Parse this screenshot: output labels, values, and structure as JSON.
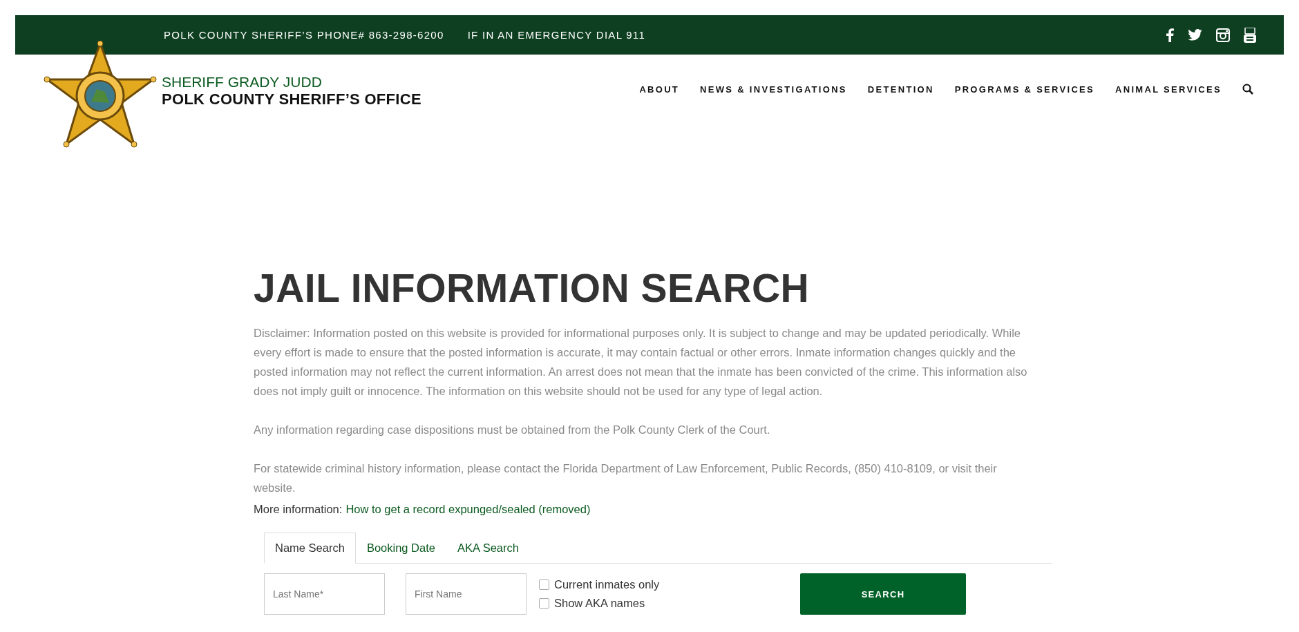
{
  "top_bar": {
    "phone": "POLK COUNTY SHERIFF’S PHONE# 863-298-6200",
    "emergency": "IF IN AN EMERGENCY DIAL 911"
  },
  "header": {
    "subtitle": "SHERIFF GRADY JUDD",
    "title": "POLK COUNTY SHERIFF’S OFFICE"
  },
  "nav": [
    "ABOUT",
    "NEWS & INVESTIGATIONS",
    "DETENTION",
    "PROGRAMS & SERVICES",
    "ANIMAL SERVICES"
  ],
  "heading": "JAIL INFORMATION SEARCH",
  "paragraphs": [
    "Disclaimer: Information posted on this website is provided for informational purposes only. It is subject to change and may be updated periodically. While every effort is made to ensure that the posted information is accurate, it may contain factual or other errors. Inmate information changes quickly and the posted information may not reflect the current information. An arrest does not mean that the inmate has been convicted of the crime. This information also does not imply guilt or innocence.  The information on this website should not be used for any type of legal action.",
    "Any information regarding case dispositions must be obtained from the Polk County Clerk of the Court.",
    "For statewide criminal history information, please contact the Florida Department of Law Enforcement, Public Records, (850) 410-8109, or visit their website."
  ],
  "more_info": {
    "label": "More information:",
    "link": "How to get a record expunged/sealed (removed)"
  },
  "tabs": [
    {
      "label": "Name Search",
      "selected": true
    },
    {
      "label": "Booking Date",
      "selected": false
    },
    {
      "label": "AKA Search",
      "selected": false
    }
  ],
  "fields": [
    {
      "placeholder": "Last Name*"
    },
    {
      "placeholder": "First Name"
    }
  ],
  "checkboxes": [
    {
      "label": "Current inmates only",
      "checked": false
    },
    {
      "label": "Show AKA names",
      "checked": false
    }
  ],
  "search_button": "SEARCH"
}
